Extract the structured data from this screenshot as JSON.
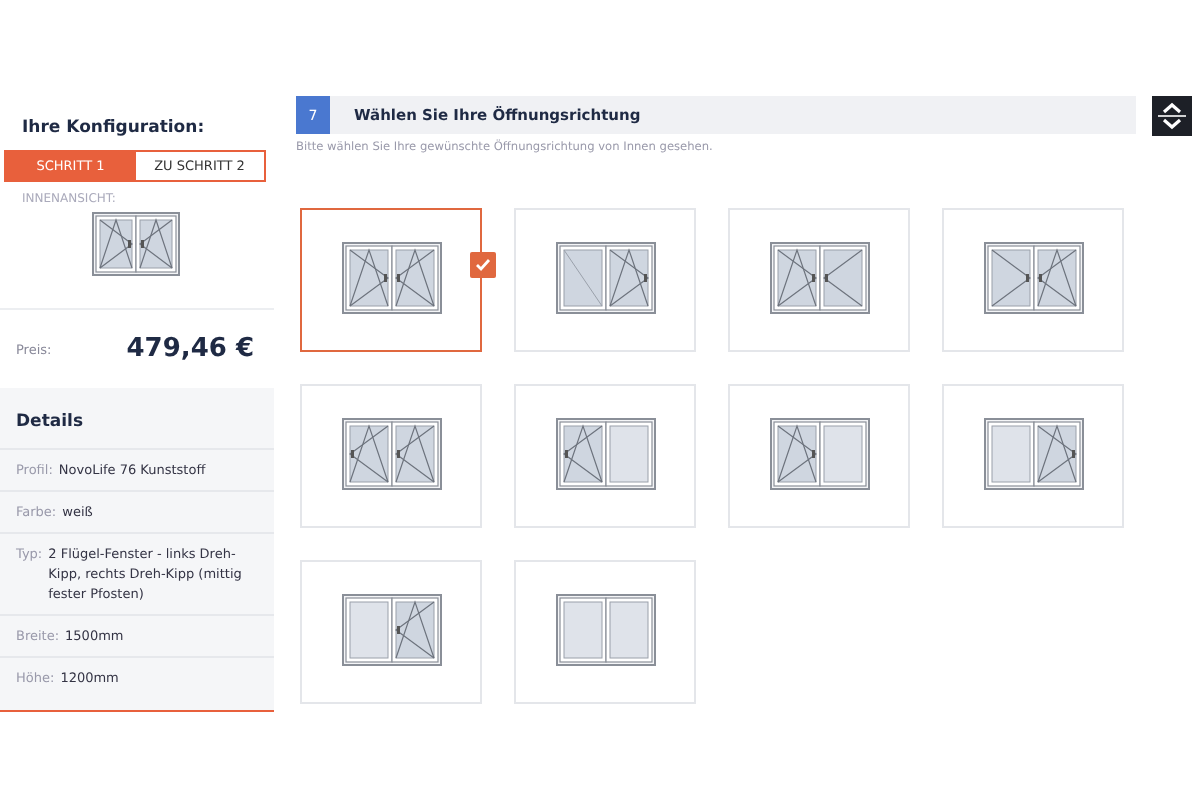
{
  "sidebar": {
    "title": "Ihre Konfiguration:",
    "tabs": [
      {
        "label": "SCHRITT 1",
        "selected": true
      },
      {
        "label": "ZU SCHRITT 2",
        "selected": false
      }
    ],
    "view_label": "INNENANSICHT:",
    "preview": [
      {
        "kind": "tilt-turn-left"
      },
      {
        "kind": "tilt-turn-right"
      }
    ],
    "price_label": "Preis:",
    "price": "479,46 €",
    "details_title": "Details",
    "details": [
      {
        "label": "Profil:",
        "value": "NovoLife 76 Kunststoff"
      },
      {
        "label": "Farbe:",
        "value": "weiß"
      },
      {
        "label": "Typ:",
        "value": "2 Flügel-Fenster - links Dreh-Kipp, rechts Dreh-Kipp (mittig fester Pfosten)"
      },
      {
        "label": "Breite:",
        "value": "1500mm"
      },
      {
        "label": "Höhe:",
        "value": "1200mm"
      }
    ]
  },
  "section": {
    "number": "7",
    "title": "Wählen Sie Ihre Öffnungsrichtung",
    "hint": "Bitte wählen Sie Ihre gewünschte Öffnungsrichtung von Innen gesehen.",
    "options": [
      {
        "selected": true,
        "panes": [
          {
            "kind": "tilt-turn-left"
          },
          {
            "kind": "tilt-turn-right"
          }
        ]
      },
      {
        "selected": false,
        "panes": [
          {
            "kind": "fixed-sash"
          },
          {
            "kind": "tilt-turn-left"
          }
        ]
      },
      {
        "selected": false,
        "panes": [
          {
            "kind": "tilt-turn-left"
          },
          {
            "kind": "turn-right"
          }
        ]
      },
      {
        "selected": false,
        "panes": [
          {
            "kind": "turn-left"
          },
          {
            "kind": "tilt-turn-right"
          }
        ]
      },
      {
        "selected": false,
        "panes": [
          {
            "kind": "tilt-turn-right"
          },
          {
            "kind": "tilt-turn-right"
          }
        ]
      },
      {
        "selected": false,
        "panes": [
          {
            "kind": "tilt-turn-right"
          },
          {
            "kind": "fixed"
          }
        ]
      },
      {
        "selected": false,
        "panes": [
          {
            "kind": "tilt-turn-left"
          },
          {
            "kind": "fixed"
          }
        ]
      },
      {
        "selected": false,
        "panes": [
          {
            "kind": "fixed"
          },
          {
            "kind": "tilt-turn-left"
          }
        ]
      },
      {
        "selected": false,
        "panes": [
          {
            "kind": "fixed"
          },
          {
            "kind": "tilt-turn-right"
          }
        ]
      },
      {
        "selected": false,
        "panes": [
          {
            "kind": "fixed"
          },
          {
            "kind": "fixed"
          }
        ]
      }
    ]
  }
}
